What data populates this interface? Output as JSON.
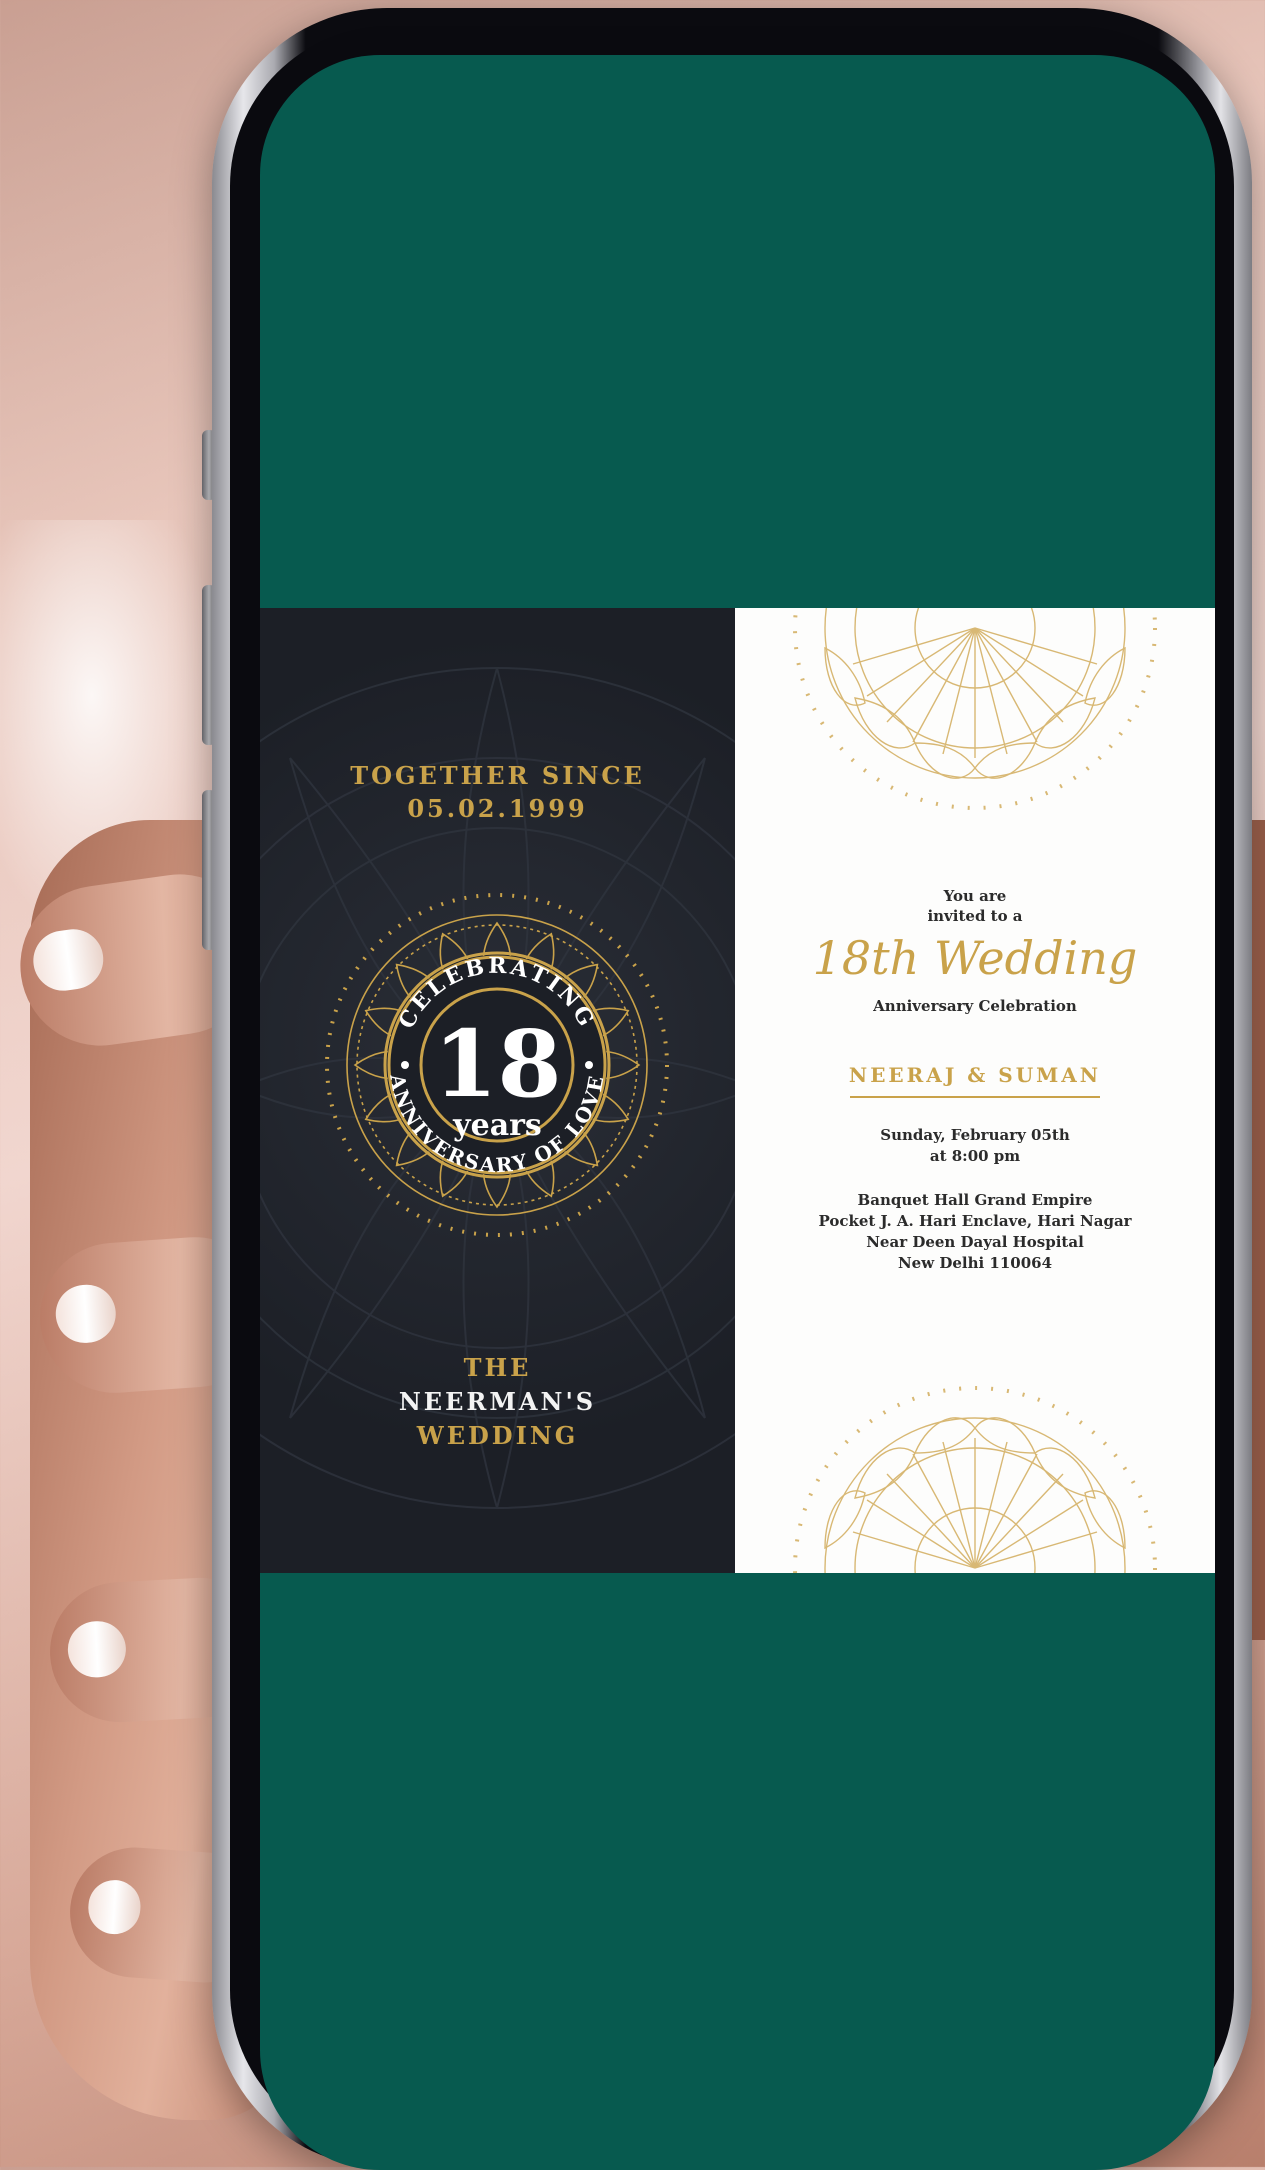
{
  "invitation": {
    "left": {
      "together_line1": "TOGETHER SINCE",
      "together_line2": "05.02.1999",
      "ring_top": "CELEBRATING",
      "ring_bottom": "ANNIVERSARY OF LOVE",
      "number": "18",
      "years": "years",
      "title_line1": "THE",
      "title_line2": "NEERMAN'S",
      "title_line3": "WEDDING"
    },
    "right": {
      "intro_line1": "You are",
      "intro_line2": "invited to a",
      "script_title": "18th Wedding",
      "subtitle": "Anniversary Celebration",
      "names": "NEERAJ & SUMAN",
      "date_line1": "Sunday, February 05th",
      "date_line2": "at 8:00 pm",
      "address_line1": "Banquet Hall Grand Empire",
      "address_line2": "Pocket J. A. Hari Enclave, Hari Nagar",
      "address_line3": "Near Deen Dayal Hospital",
      "address_line4": "New Delhi 110064"
    }
  },
  "colors": {
    "screen_bg": "#075a4f",
    "dark_panel": "#1c1f26",
    "gold": "#c9a24a",
    "light_panel": "#fdfdfc"
  }
}
